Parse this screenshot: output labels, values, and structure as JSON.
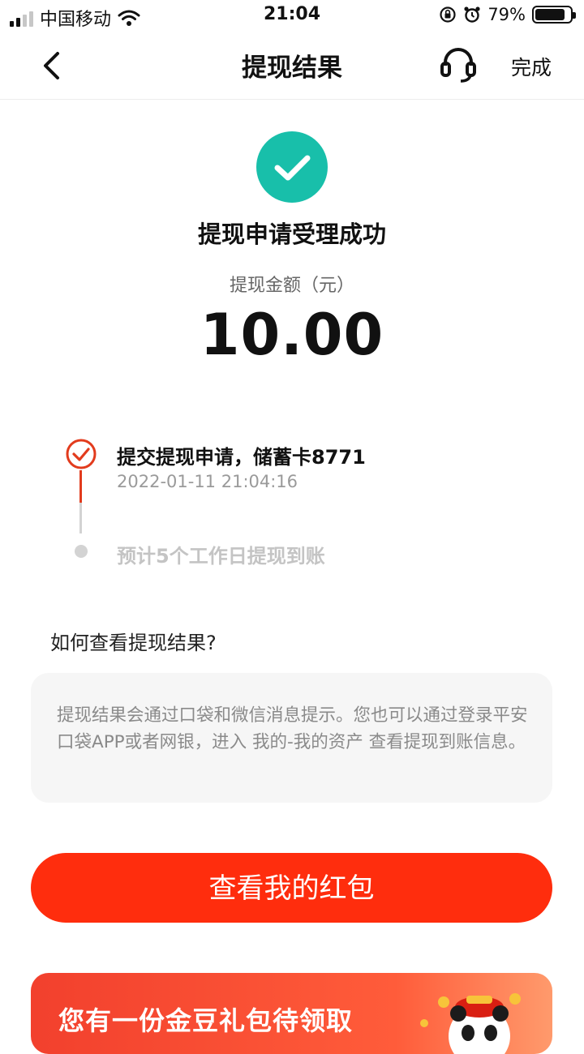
{
  "status_bar": {
    "carrier": "中国移动",
    "time": "21:04",
    "battery": "79%",
    "battery_level": 0.79
  },
  "nav": {
    "title": "提现结果",
    "done": "完成",
    "icons": [
      "back-arrow-icon",
      "headset-icon"
    ]
  },
  "result": {
    "title": "提现申请受理成功",
    "amount_label": "提现金额（元）",
    "amount": "10.00",
    "accent": "#18bfaa"
  },
  "timeline": {
    "steps": [
      {
        "title": "提交提现申请，储蓄卡8771",
        "time": "2022-01-11 21:04:16",
        "status": "done"
      },
      {
        "title": "预计5个工作日提现到账",
        "status": "pending"
      }
    ]
  },
  "help": {
    "question": "如何查看提现结果?",
    "answer": "提现结果会通过口袋和微信消息提示。您也可以通过登录平安口袋APP或者网银，进入 我的-我的资产 查看提现到账信息。"
  },
  "actions": {
    "primary": "查看我的红包",
    "primary_color": "#ff2d0d"
  },
  "banner": {
    "text": "您有一份金豆礼包待领取"
  }
}
